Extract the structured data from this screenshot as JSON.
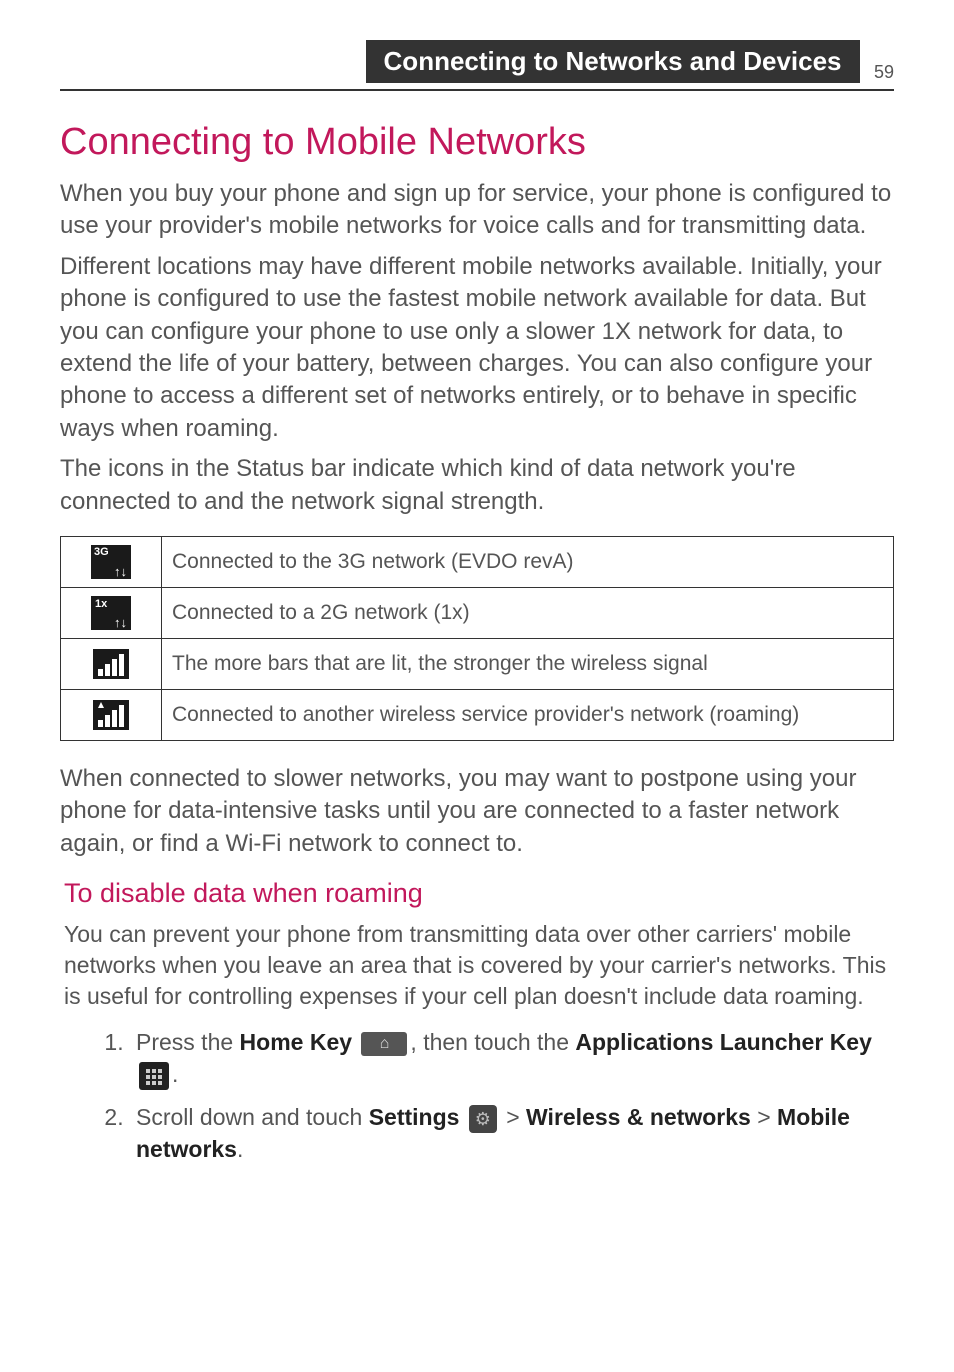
{
  "header": {
    "chapter_title": "Connecting to Networks and Devices",
    "page_number": "59"
  },
  "main": {
    "h1": "Connecting to Mobile Networks",
    "p1": "When you buy your phone and sign up for service, your phone is configured to use your provider's mobile networks for voice calls and for transmitting data.",
    "p2": "Different locations may have different mobile networks available. Initially, your phone is configured to use the fastest mobile network available for data. But you can configure your phone to use only a slower 1X network for data, to extend the life of your battery, between charges. You can also configure your phone to access a different set of networks entirely, or to behave in specific ways when roaming.",
    "p3": "The icons in the Status bar indicate which kind of data network you're connected to and the network signal strength.",
    "table": {
      "rows": [
        {
          "icon": "3g-icon",
          "text": "Connected to the 3G network (EVDO revA)"
        },
        {
          "icon": "1x-icon",
          "text": "Connected to a 2G network (1x)"
        },
        {
          "icon": "signal-bars-icon",
          "text": "The more bars that are lit, the stronger the wireless signal"
        },
        {
          "icon": "roaming-bars-icon",
          "text": "Connected to another wireless service provider's network (roaming)"
        }
      ]
    },
    "p4": "When connected to slower networks, you may want to postpone using your phone for data-intensive tasks until you are connected to a faster network again, or find a Wi-Fi network to connect to.",
    "h2": "To disable data when roaming",
    "p5": "You can prevent your phone from transmitting data over other carriers' mobile networks when you leave an area that is covered by your carrier's networks. This is useful for controlling expenses if your cell plan doesn't include data roaming.",
    "steps": {
      "s1_a": "Press the ",
      "s1_home": "Home Key",
      "s1_b": ", then touch the ",
      "s1_apps": "Applications Launcher Key",
      "s1_c": ".",
      "s2_a": "Scroll down and touch ",
      "s2_settings": "Settings",
      "s2_b": " > ",
      "s2_wireless": "Wireless & networks",
      "s2_c": " > ",
      "s2_mobile": "Mobile networks",
      "s2_d": "."
    }
  }
}
